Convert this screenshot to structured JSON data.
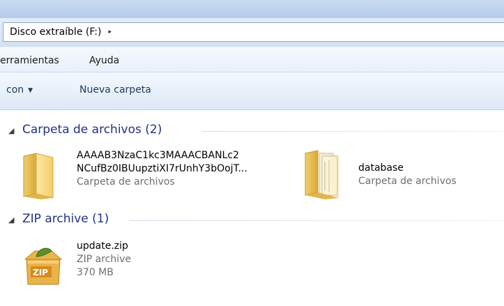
{
  "address": {
    "crumb": "Disco extraíble (F:)",
    "arrow": "▸"
  },
  "menu": {
    "items": [
      "erramientas",
      "Ayuda"
    ]
  },
  "toolbar": {
    "organize_label": "con",
    "caret": "▼",
    "new_folder_label": "Nueva carpeta"
  },
  "groups": [
    {
      "title": "Carpeta de archivos (2)",
      "toggle": "◢",
      "items": [
        {
          "name_line1": "AAAAB3NzaC1kc3MAAACBANLc2",
          "name_line2": "NCufBz0IBUupztiXI7rUnhY3bOojT...",
          "type": "Carpeta de archivos",
          "icon": "folder-icon"
        },
        {
          "name_line1": "database",
          "type": "Carpeta de archivos",
          "icon": "folder-with-documents-icon"
        }
      ]
    },
    {
      "title": "ZIP archive (1)",
      "toggle": "◢",
      "items": [
        {
          "name_line1": "update.zip",
          "type": "ZIP archive",
          "size": "370 MB",
          "icon": "zip-archive-icon"
        }
      ]
    }
  ],
  "colors": {
    "group_title": "#1e3287",
    "toolbar_text": "#1e395b",
    "secondary_text": "#6d6d6d"
  }
}
